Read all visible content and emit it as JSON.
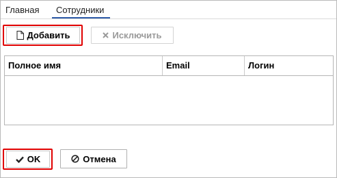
{
  "tabs": [
    {
      "label": "Главная",
      "active": false
    },
    {
      "label": "Сотрудники",
      "active": true
    }
  ],
  "toolbar": {
    "add_label": "Добавить",
    "add_icon": "document-icon",
    "exclude_label": "Исключить",
    "exclude_icon": "x-icon",
    "exclude_disabled": true
  },
  "table": {
    "columns": [
      "Полное имя",
      "Email",
      "Логин"
    ],
    "rows": []
  },
  "footer": {
    "ok_label": "OK",
    "ok_icon": "checkmark-icon",
    "cancel_label": "Отмена",
    "cancel_icon": "cancel-circle-icon"
  },
  "colors": {
    "highlight": "#e00000",
    "tab_active_underline": "#2c5aa8",
    "disabled_text": "#9a9a9a"
  }
}
